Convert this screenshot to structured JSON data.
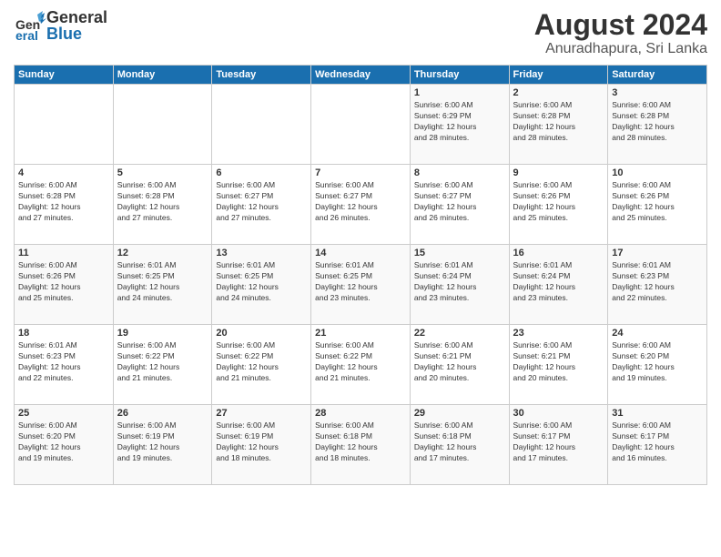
{
  "header": {
    "logo_line1": "General",
    "logo_line2": "Blue",
    "title": "August 2024",
    "subtitle": "Anuradhapura, Sri Lanka"
  },
  "weekdays": [
    "Sunday",
    "Monday",
    "Tuesday",
    "Wednesday",
    "Thursday",
    "Friday",
    "Saturday"
  ],
  "weeks": [
    [
      {
        "day": "",
        "info": ""
      },
      {
        "day": "",
        "info": ""
      },
      {
        "day": "",
        "info": ""
      },
      {
        "day": "",
        "info": ""
      },
      {
        "day": "1",
        "info": "Sunrise: 6:00 AM\nSunset: 6:29 PM\nDaylight: 12 hours\nand 28 minutes."
      },
      {
        "day": "2",
        "info": "Sunrise: 6:00 AM\nSunset: 6:28 PM\nDaylight: 12 hours\nand 28 minutes."
      },
      {
        "day": "3",
        "info": "Sunrise: 6:00 AM\nSunset: 6:28 PM\nDaylight: 12 hours\nand 28 minutes."
      }
    ],
    [
      {
        "day": "4",
        "info": "Sunrise: 6:00 AM\nSunset: 6:28 PM\nDaylight: 12 hours\nand 27 minutes."
      },
      {
        "day": "5",
        "info": "Sunrise: 6:00 AM\nSunset: 6:28 PM\nDaylight: 12 hours\nand 27 minutes."
      },
      {
        "day": "6",
        "info": "Sunrise: 6:00 AM\nSunset: 6:27 PM\nDaylight: 12 hours\nand 27 minutes."
      },
      {
        "day": "7",
        "info": "Sunrise: 6:00 AM\nSunset: 6:27 PM\nDaylight: 12 hours\nand 26 minutes."
      },
      {
        "day": "8",
        "info": "Sunrise: 6:00 AM\nSunset: 6:27 PM\nDaylight: 12 hours\nand 26 minutes."
      },
      {
        "day": "9",
        "info": "Sunrise: 6:00 AM\nSunset: 6:26 PM\nDaylight: 12 hours\nand 25 minutes."
      },
      {
        "day": "10",
        "info": "Sunrise: 6:00 AM\nSunset: 6:26 PM\nDaylight: 12 hours\nand 25 minutes."
      }
    ],
    [
      {
        "day": "11",
        "info": "Sunrise: 6:00 AM\nSunset: 6:26 PM\nDaylight: 12 hours\nand 25 minutes."
      },
      {
        "day": "12",
        "info": "Sunrise: 6:01 AM\nSunset: 6:25 PM\nDaylight: 12 hours\nand 24 minutes."
      },
      {
        "day": "13",
        "info": "Sunrise: 6:01 AM\nSunset: 6:25 PM\nDaylight: 12 hours\nand 24 minutes."
      },
      {
        "day": "14",
        "info": "Sunrise: 6:01 AM\nSunset: 6:25 PM\nDaylight: 12 hours\nand 23 minutes."
      },
      {
        "day": "15",
        "info": "Sunrise: 6:01 AM\nSunset: 6:24 PM\nDaylight: 12 hours\nand 23 minutes."
      },
      {
        "day": "16",
        "info": "Sunrise: 6:01 AM\nSunset: 6:24 PM\nDaylight: 12 hours\nand 23 minutes."
      },
      {
        "day": "17",
        "info": "Sunrise: 6:01 AM\nSunset: 6:23 PM\nDaylight: 12 hours\nand 22 minutes."
      }
    ],
    [
      {
        "day": "18",
        "info": "Sunrise: 6:01 AM\nSunset: 6:23 PM\nDaylight: 12 hours\nand 22 minutes."
      },
      {
        "day": "19",
        "info": "Sunrise: 6:00 AM\nSunset: 6:22 PM\nDaylight: 12 hours\nand 21 minutes."
      },
      {
        "day": "20",
        "info": "Sunrise: 6:00 AM\nSunset: 6:22 PM\nDaylight: 12 hours\nand 21 minutes."
      },
      {
        "day": "21",
        "info": "Sunrise: 6:00 AM\nSunset: 6:22 PM\nDaylight: 12 hours\nand 21 minutes."
      },
      {
        "day": "22",
        "info": "Sunrise: 6:00 AM\nSunset: 6:21 PM\nDaylight: 12 hours\nand 20 minutes."
      },
      {
        "day": "23",
        "info": "Sunrise: 6:00 AM\nSunset: 6:21 PM\nDaylight: 12 hours\nand 20 minutes."
      },
      {
        "day": "24",
        "info": "Sunrise: 6:00 AM\nSunset: 6:20 PM\nDaylight: 12 hours\nand 19 minutes."
      }
    ],
    [
      {
        "day": "25",
        "info": "Sunrise: 6:00 AM\nSunset: 6:20 PM\nDaylight: 12 hours\nand 19 minutes."
      },
      {
        "day": "26",
        "info": "Sunrise: 6:00 AM\nSunset: 6:19 PM\nDaylight: 12 hours\nand 19 minutes."
      },
      {
        "day": "27",
        "info": "Sunrise: 6:00 AM\nSunset: 6:19 PM\nDaylight: 12 hours\nand 18 minutes."
      },
      {
        "day": "28",
        "info": "Sunrise: 6:00 AM\nSunset: 6:18 PM\nDaylight: 12 hours\nand 18 minutes."
      },
      {
        "day": "29",
        "info": "Sunrise: 6:00 AM\nSunset: 6:18 PM\nDaylight: 12 hours\nand 17 minutes."
      },
      {
        "day": "30",
        "info": "Sunrise: 6:00 AM\nSunset: 6:17 PM\nDaylight: 12 hours\nand 17 minutes."
      },
      {
        "day": "31",
        "info": "Sunrise: 6:00 AM\nSunset: 6:17 PM\nDaylight: 12 hours\nand 16 minutes."
      }
    ]
  ]
}
